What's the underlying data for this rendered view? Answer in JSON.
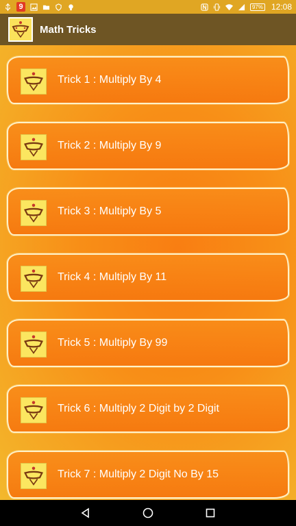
{
  "status_bar": {
    "badge": "9",
    "battery": "97",
    "time": "12:08"
  },
  "app_bar": {
    "title": "Math Tricks"
  },
  "tricks": [
    {
      "label": "Trick 1 : Multiply By 4"
    },
    {
      "label": "Trick 2 : Multiply By 9"
    },
    {
      "label": "Trick 3 : Multiply By 5"
    },
    {
      "label": "Trick 4 : Multiply By 11"
    },
    {
      "label": "Trick 5 : Multiply By 99"
    },
    {
      "label": "Trick 6 : Multiply 2 Digit by 2 Digit"
    },
    {
      "label": "Trick 7 : Multiply 2 Digit No By 15"
    }
  ],
  "nav_bar": {
    "icons": [
      "back-icon",
      "home-icon",
      "recents-icon"
    ]
  }
}
